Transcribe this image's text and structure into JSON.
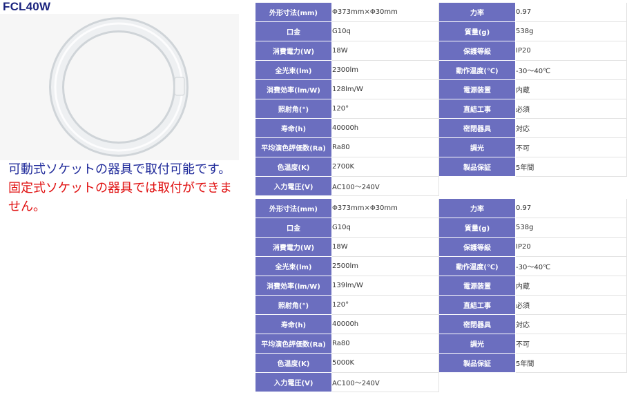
{
  "product": {
    "title": "FCL40W",
    "image_alt": "circular fluorescent lamp"
  },
  "note": {
    "line1": "可動式ソケットの器具で取付可能です。",
    "line2": "固定式ソケットの器具では取付ができません。"
  },
  "spec_tables": [
    {
      "rows": [
        {
          "l1": "外形寸法(mm)",
          "v1": "Φ373mm×Φ30mm",
          "l2": "力率",
          "v2": "0.97"
        },
        {
          "l1": "口金",
          "v1": "G10q",
          "l2": "質量(g)",
          "v2": "538g"
        },
        {
          "l1": "消費電力(W)",
          "v1": "18W",
          "l2": "保護等級",
          "v2": "IP20"
        },
        {
          "l1": "全光束(lm)",
          "v1": "2300lm",
          "l2": "動作温度(℃)",
          "v2": "-30～40℃"
        },
        {
          "l1": "消費効率(lm/W)",
          "v1": "128lm/W",
          "l2": "電源装置",
          "v2": "内蔵"
        },
        {
          "l1": "照射角(°)",
          "v1": "120°",
          "l2": "直結工事",
          "v2": "必須"
        },
        {
          "l1": "寿命(h)",
          "v1": "40000h",
          "l2": "密閉器具",
          "v2": "対応"
        },
        {
          "l1": "平均演色評価数(Ra)",
          "v1": "Ra80",
          "l2": "調光",
          "v2": "不可"
        },
        {
          "l1": "色温度(K)",
          "v1": "2700K",
          "l2": "製品保証",
          "v2": "5年間"
        },
        {
          "l1": "入力電圧(V)",
          "v1": "AC100～240V",
          "l2": "",
          "v2": ""
        }
      ]
    },
    {
      "rows": [
        {
          "l1": "外形寸法(mm)",
          "v1": "Φ373mm×Φ30mm",
          "l2": "力率",
          "v2": "0.97"
        },
        {
          "l1": "口金",
          "v1": "G10q",
          "l2": "質量(g)",
          "v2": "538g"
        },
        {
          "l1": "消費電力(W)",
          "v1": "18W",
          "l2": "保護等級",
          "v2": "IP20"
        },
        {
          "l1": "全光束(lm)",
          "v1": "2500lm",
          "l2": "動作温度(℃)",
          "v2": "-30～40℃"
        },
        {
          "l1": "消費効率(lm/W)",
          "v1": "139lm/W",
          "l2": "電源装置",
          "v2": "内蔵"
        },
        {
          "l1": "照射角(°)",
          "v1": "120°",
          "l2": "直結工事",
          "v2": "必須"
        },
        {
          "l1": "寿命(h)",
          "v1": "40000h",
          "l2": "密閉器具",
          "v2": "対応"
        },
        {
          "l1": "平均演色評価数(Ra)",
          "v1": "Ra80",
          "l2": "調光",
          "v2": "不可"
        },
        {
          "l1": "色温度(K)",
          "v1": "5000K",
          "l2": "製品保証",
          "v2": "5年間"
        },
        {
          "l1": "入力電圧(V)",
          "v1": "AC100～240V",
          "l2": "",
          "v2": ""
        }
      ]
    }
  ],
  "colors": {
    "label_bg": "#6b6ebf",
    "title": "#1a237e",
    "note_ok": "#1f2a9a",
    "note_ng": "#e01010"
  }
}
